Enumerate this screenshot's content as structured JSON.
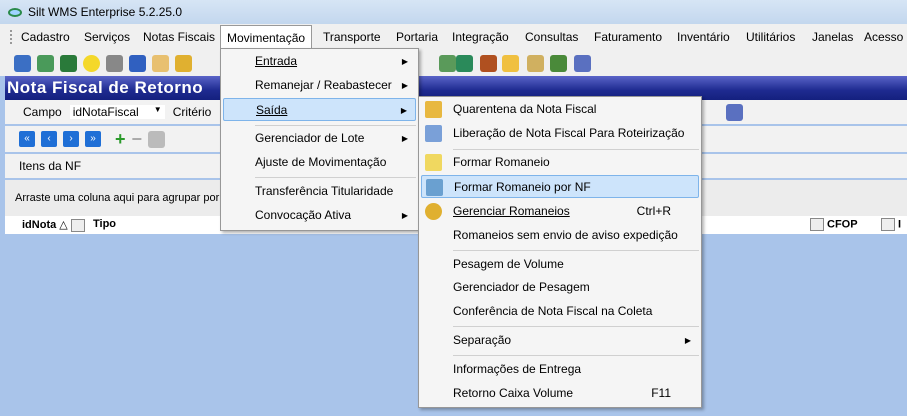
{
  "window": {
    "title": "Silt WMS Enterprise 5.2.25.0"
  },
  "menubar": [
    "Cadastro",
    "Serviços",
    "Notas Fiscais",
    "Movimentação",
    "Transporte",
    "Portaria",
    "Integração",
    "Consultas",
    "Faturamento",
    "Inventário",
    "Utilitários",
    "Janelas",
    "Acesso"
  ],
  "form": {
    "title": "Nota Fiscal de Retorno",
    "campo_label": "Campo",
    "campo_value": "idNotaFiscal",
    "criterio_label": "Critério",
    "itens_label": "Itens da NF",
    "group_hint": "Arraste uma coluna aqui para agrupar por",
    "columns": [
      "idNota",
      "Tipo",
      "CFOP",
      "I"
    ]
  },
  "movimentacao_menu": [
    {
      "label": "Entrada",
      "submenu": true
    },
    {
      "label": "Remanejar / Reabastecer",
      "submenu": true
    },
    {
      "label": "Saída",
      "submenu": true,
      "highlighted": true
    },
    {
      "label": "Gerenciador de Lote",
      "submenu": true
    },
    {
      "label": "Ajuste de Movimentação",
      "submenu": false
    },
    {
      "label": "Transferência Titularidade",
      "submenu": false
    },
    {
      "label": "Convocação Ativa",
      "submenu": true
    }
  ],
  "saida_menu": [
    {
      "label": "Quarentena da Nota Fiscal",
      "icon": "folder-quarantine-icon"
    },
    {
      "label": "Liberação de Nota Fiscal Para Roteirização",
      "icon": "checklist-icon"
    },
    {
      "label": "Formar Romaneio",
      "icon": "note-icon"
    },
    {
      "label": "Formar Romaneio por NF",
      "icon": "grid-search-icon",
      "highlighted": true
    },
    {
      "label": "Gerenciar Romaneios",
      "shortcut": "Ctrl+R",
      "icon": "stamp-icon"
    },
    {
      "label": "Romaneios sem envio de aviso expedição"
    },
    {
      "label": "Pesagem de Volume"
    },
    {
      "label": "Gerenciador de Pesagem"
    },
    {
      "label": "Conferência de Nota Fiscal na Coleta"
    },
    {
      "label": "Separação",
      "submenu": true
    },
    {
      "label": "Informações de Entrega"
    },
    {
      "label": "Retorno Caixa Volume",
      "shortcut": "F11"
    }
  ],
  "colors": {
    "header": "#1e2a90",
    "highlight": "#cde4fb",
    "background": "#a9c4ea"
  }
}
